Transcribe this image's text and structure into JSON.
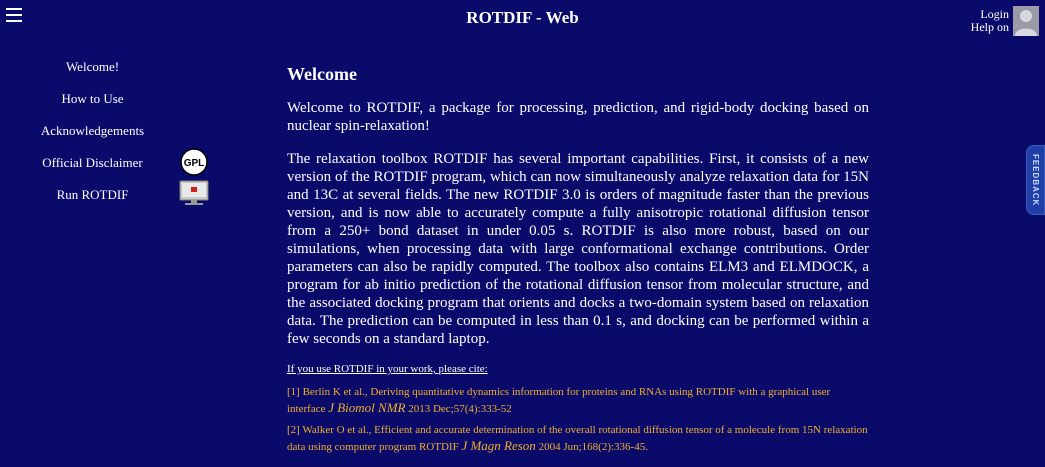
{
  "header": {
    "title": "ROTDIF - Web",
    "login_label": "Login",
    "help_label": "Help on"
  },
  "sidebar": {
    "items": [
      {
        "label": "Welcome!"
      },
      {
        "label": "How to Use"
      },
      {
        "label": "Acknowledgements"
      },
      {
        "label": "Official Disclaimer"
      },
      {
        "label": "Run ROTDIF"
      }
    ],
    "gpl_badge_text": "GPL"
  },
  "main": {
    "heading": "Welcome",
    "intro": "Welcome to ROTDIF, a package for processing, prediction, and rigid-body docking based on nuclear spin-relaxation!",
    "description": "The relaxation toolbox ROTDIF has several important capabilities. First, it consists of a new version of the ROTDIF program, which can now simultaneously analyze relaxation data for 15N and 13C at several fields. The new ROTDIF 3.0 is orders of magnitude faster than the previous version, and is now able to accurately compute a fully anisotropic rotational diffusion tensor from a 250+ bond dataset in under 0.05 s. ROTDIF is also more robust, based on our simulations, when processing data with large conformational exchange contributions. Order parameters can also be rapidly computed. The toolbox also contains ELM3 and ELMDOCK, a program for ab initio prediction of the rotational diffusion tensor from molecular structure, and the associated docking program that orients and docks a two-domain system based on relaxation data. The prediction can be computed in less than 0.1 s, and docking can be performed within a few seconds on a standard laptop.",
    "cite_header": "If you use ROTDIF in your work, please cite:",
    "references": [
      {
        "text": "[1] Berlin K et al., Deriving quantitative dynamics information for proteins and RNAs using ROTDIF with a graphical user interface ",
        "journal": "J Biomol NMR",
        "details": " 2013 Dec;57(4):333-52"
      },
      {
        "text": "[2] Walker O et al., Efficient and accurate determination of the overall rotational diffusion tensor of a molecule from 15N relaxation data using computer program ROTDIF ",
        "journal": "J Magn Reson",
        "details": " 2004 Jun;168(2):336-45."
      }
    ]
  },
  "feedback": {
    "label": "FEEDBACK"
  },
  "colors": {
    "background": "#0a0a6a",
    "reference": "#f0b030",
    "feedback_tab": "#1f3fa6"
  }
}
